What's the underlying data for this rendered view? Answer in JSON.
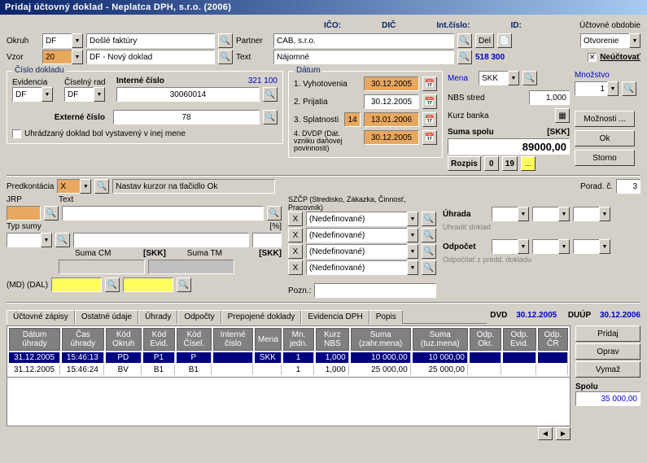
{
  "title": "Pridaj účtovný doklad - Neplatca DPH, s.r.o. (2006)",
  "top_labels": {
    "ico": "IČO:",
    "dic": "DIČ",
    "intcislo": "Int.číslo:",
    "id": "ID:"
  },
  "ucto_obdobie": {
    "label": "Účtovné obdobie",
    "value": "Otvorenie"
  },
  "okruh": {
    "label": "Okruh",
    "value": "DF",
    "desc": "Došlé faktúry"
  },
  "vzor": {
    "label": "Vzor",
    "value": "20",
    "desc": "DF - Nový doklad"
  },
  "partner": {
    "label": "Partner",
    "value": "CAB, s.r.o."
  },
  "text": {
    "label": "Text",
    "value": "Nájomné"
  },
  "idlink": "518 300",
  "neuctovat": "Neúčtovať",
  "cislo_dokladu": {
    "legend": "Číslo dokladu",
    "evidencia": {
      "label": "Evidencia",
      "value": "DF"
    },
    "ciselny_rad": {
      "label": "Číselný rad",
      "value": "DF"
    },
    "interne_cislo": {
      "label": "Interné číslo",
      "link": "321 100",
      "value": "30060014"
    },
    "externe_cislo": {
      "label": "Externé číslo",
      "value": "78"
    },
    "uhr_check": "Uhrádzaný doklad bol vystavený v inej mene"
  },
  "datum": {
    "legend": "Dátum",
    "vyhotovenia": {
      "label": "1. Vyhotovenia",
      "value": "30.12.2005"
    },
    "prijatia": {
      "label": "2. Prijatia",
      "value": "30.12.2005"
    },
    "splatnosti": {
      "label": "3. Splatnosti",
      "days": "14",
      "value": "13.01.2006"
    },
    "dvdp": {
      "label": "4. DVDP (Dát. vzniku daňovej povinnosti)",
      "value": "30.12.2005"
    }
  },
  "mena": {
    "label": "Mena",
    "value": "SKK"
  },
  "mnozstvo": {
    "label": "Množstvo",
    "value": "1"
  },
  "nbs": {
    "label": "NBS stred",
    "value": "1,000"
  },
  "kurz_banka": "Kurz banka",
  "suma_spolu": {
    "label": "Suma spolu",
    "unit": "[SKK]",
    "value": "89000,00"
  },
  "rozpis": {
    "label": "Rozpis",
    "b1": "0",
    "b2": "19",
    "b3": "..."
  },
  "moznosti": "Možnosti ...",
  "ok": "Ok",
  "storno": "Storno",
  "del": "Del",
  "predkontacia": {
    "label": "Predkontácia",
    "value": "X",
    "hint": "Nastav kurzor na tlačidlo Ok"
  },
  "poradc": {
    "label": "Porad. č.",
    "value": "3"
  },
  "jrp": "JRP",
  "typ_sumy": "Typ sumy",
  "pct": "[%]",
  "suma_cm": "Suma CM",
  "suma_tm": "Suma TM",
  "skk": "[SKK]",
  "md_dal": "(MD) (DAL)",
  "text2": "Text",
  "szcp": "SZČP (Stredisko, Zákazka, Činnosť, Pracovník)",
  "nedef": "(Nedefinované)",
  "x": "X",
  "uhrada": {
    "label": "Úhrada",
    "sub": "Uhradiť doklad"
  },
  "odpocet": {
    "label": "Odpočet",
    "sub": "Odpočítať z predd. dokladu"
  },
  "pozn": "Pozn.:",
  "tabs": [
    "Účtovné zápisy",
    "Ostatné údaje",
    "Úhrady",
    "Odpočty",
    "Prepojené doklady",
    "Evidencia DPH",
    "Popis"
  ],
  "active_tab": 2,
  "dvd": {
    "label": "DVD",
    "value": "30.12.2005"
  },
  "duup": {
    "label": "DUÚP",
    "value": "30.12.2006"
  },
  "grid": {
    "headers": [
      "Dátum úhrady",
      "Čas úhrady",
      "Kód Okruh",
      "Kód Evid.",
      "Kód Čísel.",
      "Interné číslo",
      "Mena",
      "Mn. jedn.",
      "Kurz NBS",
      "Suma (zahr.mena)",
      "Suma (tuz.mena)",
      "Odp. Okr.",
      "Odp. Evid.",
      "Odp. ČR"
    ],
    "rows": [
      [
        "31.12.2005",
        "15:46:13",
        "PD",
        "P1",
        "P",
        "",
        "SKK",
        "1",
        "1,000",
        "10 000,00",
        "10 000,00",
        "",
        "",
        ""
      ],
      [
        "31.12.2005",
        "15:46:24",
        "BV",
        "B1",
        "B1",
        "",
        "",
        "1",
        "1,000",
        "25 000,00",
        "25 000,00",
        "",
        "",
        ""
      ]
    ]
  },
  "side_btns": {
    "pridaj": "Pridaj",
    "oprav": "Oprav",
    "vymaz": "Vymaž"
  },
  "spolu": {
    "label": "Spolu",
    "value": "35 000,00"
  }
}
